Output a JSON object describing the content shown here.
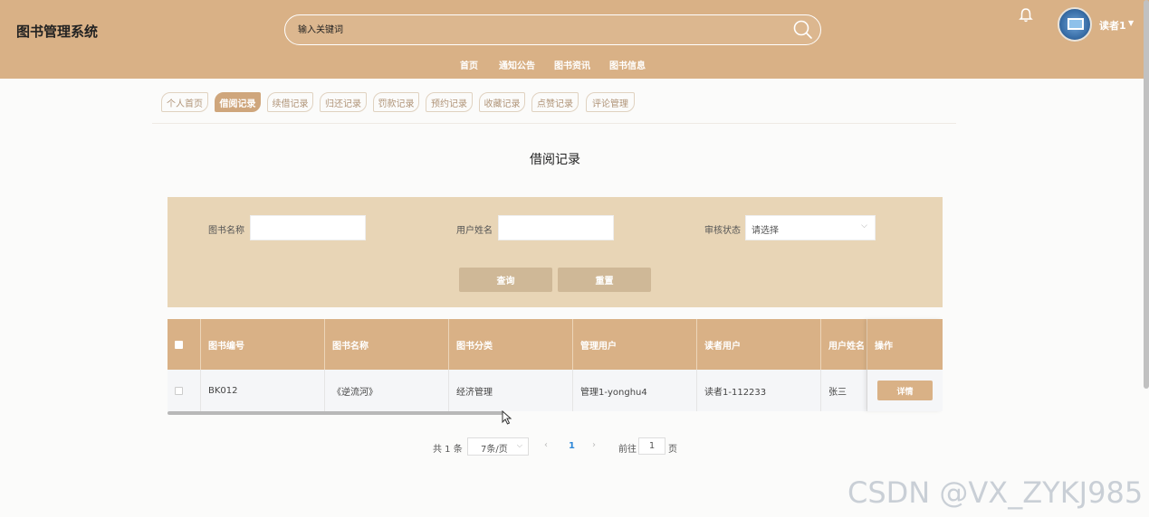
{
  "header": {
    "brand": "图书管理系统",
    "search_placeholder": "输入关键词",
    "nav": [
      "首页",
      "通知公告",
      "图书资讯",
      "图书信息"
    ],
    "user_name": "读者1"
  },
  "tabs": [
    "个人首页",
    "借阅记录",
    "续借记录",
    "归还记录",
    "罚款记录",
    "预约记录",
    "收藏记录",
    "点赞记录",
    "评论管理"
  ],
  "active_tab": "借阅记录",
  "page_title": "借阅记录",
  "filter": {
    "book_name_label": "图书名称",
    "user_name_label": "用户姓名",
    "status_label": "审核状态",
    "status_placeholder": "请选择",
    "search_button": "查询",
    "reset_button": "重置"
  },
  "table": {
    "columns": [
      "图书编号",
      "图书名称",
      "图书分类",
      "管理用户",
      "读者用户",
      "用户姓名",
      "操作"
    ],
    "rows": [
      {
        "book_no": "BK012",
        "book_name": "《逆流河》",
        "category": "经济管理",
        "admin_user": "管理1-yonghu4",
        "reader_user": "读者1-112233",
        "user_name": "张三",
        "action": "详情"
      }
    ]
  },
  "pagination": {
    "total": "共 1 条",
    "page_size": "7条/页",
    "current_page": "1",
    "goto_label": "前往",
    "goto_value": "1",
    "page_unit": "页"
  },
  "watermark": "CSDN @VX_ZYKJ985",
  "colors": {
    "header": "#d9b186",
    "filter_bg": "#e8d5b6",
    "button": "#cfb897"
  }
}
